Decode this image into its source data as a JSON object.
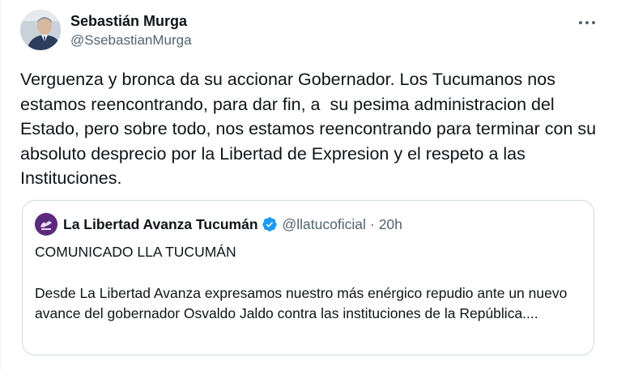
{
  "author": {
    "display_name": "Sebastián Murga",
    "handle": "@SsebastianMurga",
    "avatar_icon": "profile-photo"
  },
  "more_icon": "more-horizontal-icon",
  "tweet": {
    "text": "Verguenza y bronca da su accionar Gobernador. Los Tucumanos nos estamos reencontrando, para dar fin, a  su pesima administracion del Estado, pero sobre todo, nos estamos reencontrando para terminar con su absoluto desprecio por la Libertad de Expresion y el respeto a las Instituciones."
  },
  "quoted_tweet": {
    "display_name": "La Libertad Avanza Tucumán",
    "verified": true,
    "verified_color": "#1d9bf0",
    "handle": "@llatucoficial",
    "separator": "·",
    "time": "20h",
    "title": "COMUNICADO LLA TUCUMÁN",
    "body": "Desde La Libertad Avanza expresamos nuestro más enérgico repudio ante un nuevo avance del gobernador Osvaldo Jaldo contra las instituciones de la República...."
  },
  "colors": {
    "text_primary": "#0f1419",
    "text_secondary": "#536471",
    "border": "#cfd9de",
    "quote_avatar_bg": "#5b2a7d"
  }
}
